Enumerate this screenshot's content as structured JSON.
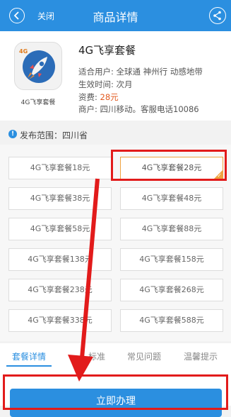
{
  "header": {
    "close_label": "关闭",
    "title": "商品详情",
    "back_icon": "chevron-left-icon",
    "share_icon": "share-icon",
    "bg_color": "#2b8fe0"
  },
  "product": {
    "logo_badge": "4G",
    "logo_caption": "4G飞享套餐",
    "name": "4G飞享套餐",
    "users_label": "适合用户: 全球通 神州行 动感地带",
    "effective_label": "生效时间: 次月",
    "fee_label": "资费: ",
    "fee_value": "28元",
    "merchant_label": "商户:  四川移动。客服电话10086"
  },
  "scope": {
    "text": "发布范围：四川省",
    "icon": "info-icon"
  },
  "options": [
    {
      "label": "4G飞享套餐18元",
      "selected": false
    },
    {
      "label": "4G飞享套餐28元",
      "selected": true
    },
    {
      "label": "4G飞享套餐38元",
      "selected": false
    },
    {
      "label": "4G飞享套餐48元",
      "selected": false
    },
    {
      "label": "4G飞享套餐58元",
      "selected": false
    },
    {
      "label": "4G飞享套餐88元",
      "selected": false
    },
    {
      "label": "4G飞享套餐138元",
      "selected": false
    },
    {
      "label": "4G飞享套餐158元",
      "selected": false
    },
    {
      "label": "4G飞享套餐238元",
      "selected": false
    },
    {
      "label": "4G飞享套餐268元",
      "selected": false
    },
    {
      "label": "4G飞享套餐338元",
      "selected": false
    },
    {
      "label": "4G飞享套餐588元",
      "selected": false
    }
  ],
  "tabs": [
    {
      "label": "套餐详情",
      "active": true
    },
    {
      "label": "标准",
      "active": false
    },
    {
      "label": "常见问题",
      "active": false
    },
    {
      "label": "温馨提示",
      "active": false
    }
  ],
  "action": {
    "label": "立即办理"
  },
  "annotation_color": "#e21b1b"
}
